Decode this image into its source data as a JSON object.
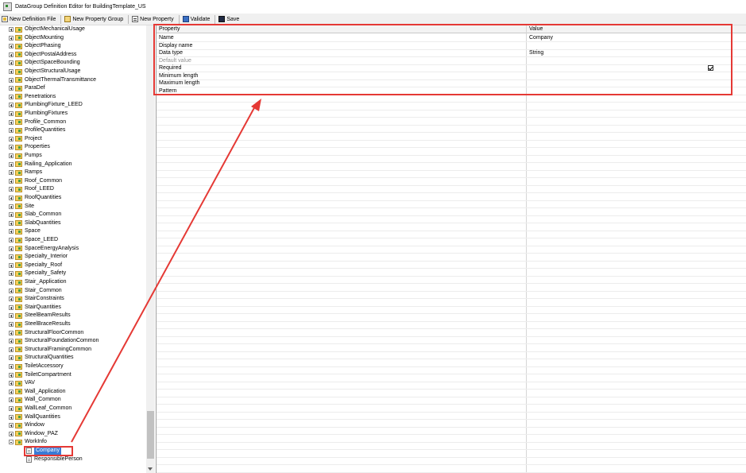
{
  "window": {
    "title": "DataGroup Definition Editor for BuildingTemplate_US"
  },
  "toolbar": {
    "new_definition_file": "New Definition File",
    "new_property_group": "New Property Group",
    "new_property": "New Property",
    "validate": "Validate",
    "save": "Save"
  },
  "tree": {
    "items": [
      "ObjectMechanicalUsage",
      "ObjectMounting",
      "ObjectPhasing",
      "ObjectPostalAddress",
      "ObjectSpaceBounding",
      "ObjectStructuralUsage",
      "ObjectThermalTransmittance",
      "ParaDef",
      "Penetrations",
      "PlumbingFixture_LEED",
      "PlumbingFixtures",
      "Profile_Common",
      "ProfileQuantities",
      "Project",
      "Properties",
      "Pumps",
      "Railing_Application",
      "Ramps",
      "Roof_Common",
      "Roof_LEED",
      "RoofQuantities",
      "Site",
      "Slab_Common",
      "SlabQuantities",
      "Space",
      "Space_LEED",
      "SpaceEnergyAnalysis",
      "Specialty_Interior",
      "Specialty_Roof",
      "Specialty_Safety",
      "Stair_Application",
      "Stair_Common",
      "StairConstraints",
      "StairQuantities",
      "SteelBeamResults",
      "SteelBraceResults",
      "StructuralFloorCommon",
      "StructuralFoundationCommon",
      "StructuralFramingCommon",
      "StructuralQuantities",
      "ToiletAccessory",
      "ToiletCompartment",
      "VAV",
      "Wall_Application",
      "Wall_Common",
      "WallLeaf_Common",
      "WallQuantities",
      "Window",
      "Window_PAZ",
      "WorkInfo"
    ],
    "children": [
      "Company",
      "ResponsiblePerson"
    ],
    "selected": "Company"
  },
  "grid": {
    "header_property": "Property",
    "header_value": "Value",
    "rows": [
      {
        "property": "Name",
        "value": "Company"
      },
      {
        "property": "Display name",
        "value": ""
      },
      {
        "property": "Data type",
        "value": "String"
      },
      {
        "property": "Default value",
        "value": ""
      },
      {
        "property": "Required",
        "value": ""
      },
      {
        "property": "Minimum length",
        "value": ""
      },
      {
        "property": "Maximum length",
        "value": ""
      },
      {
        "property": "Pattern",
        "value": ""
      }
    ],
    "required_checked": true
  },
  "colors": {
    "annotation": "#e53935",
    "selection": "#3a7bd5"
  }
}
